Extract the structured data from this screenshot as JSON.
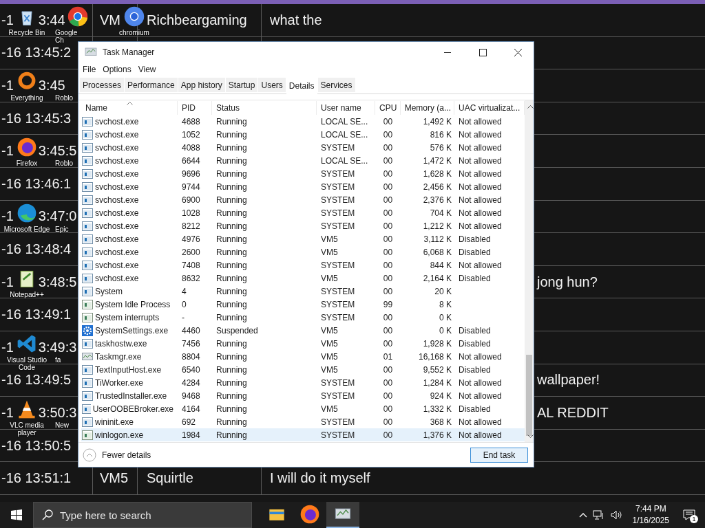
{
  "background_log": {
    "rows": [
      {
        "time": [
          "-1",
          "3:44"
        ],
        "user": "VM",
        "name": "Richbeargaming",
        "message": "what the"
      },
      {
        "time": [
          "-16 13:45:2"
        ]
      },
      {
        "time": [
          "-1",
          "3:45"
        ]
      },
      {
        "time": [
          "-16 13:45:3"
        ]
      },
      {
        "time": [
          "-1",
          "3:45:5"
        ]
      },
      {
        "time": [
          "-16 13:46:1"
        ]
      },
      {
        "time": [
          "-1",
          "3:47:0"
        ]
      },
      {
        "time": [
          "-16 13:48:4"
        ]
      },
      {
        "time": [
          "-1",
          "3:48:5"
        ],
        "message": "jong hun?"
      },
      {
        "time": [
          "-16 13:49:1"
        ]
      },
      {
        "time": [
          "-1",
          "3:49:3"
        ]
      },
      {
        "time": [
          "-16 13:49:5"
        ],
        "message": "wallpaper!"
      },
      {
        "time": [
          "-1",
          "3:50:3"
        ],
        "message": "AL REDDIT"
      },
      {
        "time": [
          "-16 13:50:5"
        ]
      },
      {
        "time": [
          "-16 13:51:1"
        ],
        "user": "VM5",
        "name": "Squirtle",
        "message": "I will do it myself"
      }
    ]
  },
  "desktop_icons": [
    {
      "label": "Recycle Bin",
      "kind": "bin"
    },
    {
      "label": "Google Ch",
      "kind": "chrome"
    },
    {
      "label": "chromium",
      "kind": "chromium"
    },
    {
      "label": "Everything",
      "kind": "ring"
    },
    {
      "label": "Roblo"
    },
    {
      "label": "Firefox",
      "kind": "fox"
    },
    {
      "label": "Roblo"
    },
    {
      "label": "Microsoft Edge",
      "kind": "edge"
    },
    {
      "label": "Epic"
    },
    {
      "label": "Notepad++",
      "kind": "note"
    },
    {
      "label": "Visual Studio Code",
      "kind": "code"
    },
    {
      "label": "fa"
    },
    {
      "label": "VLC media player",
      "kind": "cone"
    },
    {
      "label": "New"
    }
  ],
  "window": {
    "title": "Task Manager",
    "menu": [
      "File",
      "Options",
      "View"
    ],
    "tabs": [
      {
        "label": "Processes",
        "selected": false
      },
      {
        "label": "Performance",
        "selected": false
      },
      {
        "label": "App history",
        "selected": false
      },
      {
        "label": "Startup",
        "selected": false
      },
      {
        "label": "Users",
        "selected": false
      },
      {
        "label": "Details",
        "selected": true
      },
      {
        "label": "Services",
        "selected": false
      }
    ],
    "table": {
      "columns": [
        {
          "label": "Name",
          "sorted": true
        },
        {
          "label": "PID",
          "sorted": false
        },
        {
          "label": "Status",
          "sorted": false
        },
        {
          "label": "User name",
          "sorted": false
        },
        {
          "label": "CPU",
          "sorted": false
        },
        {
          "label": "Memory (a...",
          "sorted": false
        },
        {
          "label": "UAC virtualizat...",
          "sorted": false
        }
      ],
      "rows": [
        {
          "name": "svchost.exe",
          "pid": "4688",
          "status": "Running",
          "user": "LOCAL SE...",
          "cpu": "00",
          "memory": "1,492 K",
          "uac": "Not allowed",
          "kind": "exe",
          "selected": false
        },
        {
          "name": "svchost.exe",
          "pid": "1052",
          "status": "Running",
          "user": "LOCAL SE...",
          "cpu": "00",
          "memory": "816 K",
          "uac": "Not allowed",
          "kind": "exe",
          "selected": false
        },
        {
          "name": "svchost.exe",
          "pid": "4088",
          "status": "Running",
          "user": "SYSTEM",
          "cpu": "00",
          "memory": "576 K",
          "uac": "Not allowed",
          "kind": "exe",
          "selected": false
        },
        {
          "name": "svchost.exe",
          "pid": "6644",
          "status": "Running",
          "user": "LOCAL SE...",
          "cpu": "00",
          "memory": "1,472 K",
          "uac": "Not allowed",
          "kind": "exe",
          "selected": false
        },
        {
          "name": "svchost.exe",
          "pid": "9696",
          "status": "Running",
          "user": "SYSTEM",
          "cpu": "00",
          "memory": "1,628 K",
          "uac": "Not allowed",
          "kind": "exe",
          "selected": false
        },
        {
          "name": "svchost.exe",
          "pid": "9744",
          "status": "Running",
          "user": "SYSTEM",
          "cpu": "00",
          "memory": "2,456 K",
          "uac": "Not allowed",
          "kind": "exe",
          "selected": false
        },
        {
          "name": "svchost.exe",
          "pid": "6900",
          "status": "Running",
          "user": "SYSTEM",
          "cpu": "00",
          "memory": "2,376 K",
          "uac": "Not allowed",
          "kind": "exe",
          "selected": false
        },
        {
          "name": "svchost.exe",
          "pid": "1028",
          "status": "Running",
          "user": "SYSTEM",
          "cpu": "00",
          "memory": "704 K",
          "uac": "Not allowed",
          "kind": "exe",
          "selected": false
        },
        {
          "name": "svchost.exe",
          "pid": "8212",
          "status": "Running",
          "user": "SYSTEM",
          "cpu": "00",
          "memory": "1,212 K",
          "uac": "Not allowed",
          "kind": "exe",
          "selected": false
        },
        {
          "name": "svchost.exe",
          "pid": "4976",
          "status": "Running",
          "user": "VM5",
          "cpu": "00",
          "memory": "3,112 K",
          "uac": "Disabled",
          "kind": "exe",
          "selected": false
        },
        {
          "name": "svchost.exe",
          "pid": "2600",
          "status": "Running",
          "user": "VM5",
          "cpu": "00",
          "memory": "6,068 K",
          "uac": "Disabled",
          "kind": "exe",
          "selected": false
        },
        {
          "name": "svchost.exe",
          "pid": "7408",
          "status": "Running",
          "user": "SYSTEM",
          "cpu": "00",
          "memory": "844 K",
          "uac": "Not allowed",
          "kind": "exe",
          "selected": false
        },
        {
          "name": "svchost.exe",
          "pid": "8632",
          "status": "Running",
          "user": "VM5",
          "cpu": "00",
          "memory": "2,164 K",
          "uac": "Disabled",
          "kind": "exe",
          "selected": false
        },
        {
          "name": "System",
          "pid": "4",
          "status": "Running",
          "user": "SYSTEM",
          "cpu": "00",
          "memory": "20 K",
          "kind": "exe",
          "selected": false
        },
        {
          "name": "System Idle Process",
          "pid": "0",
          "status": "Running",
          "user": "SYSTEM",
          "cpu": "99",
          "memory": "8 K",
          "kind": "sys",
          "selected": false
        },
        {
          "name": "System interrupts",
          "pid": "-",
          "status": "Running",
          "user": "SYSTEM",
          "cpu": "00",
          "memory": "0 K",
          "kind": "sys",
          "selected": false
        },
        {
          "name": "SystemSettings.exe",
          "pid": "4460",
          "status": "Suspended",
          "user": "VM5",
          "cpu": "00",
          "memory": "0 K",
          "uac": "Disabled",
          "kind": "settings",
          "selected": false
        },
        {
          "name": "taskhostw.exe",
          "pid": "7456",
          "status": "Running",
          "user": "VM5",
          "cpu": "00",
          "memory": "1,928 K",
          "uac": "Disabled",
          "kind": "exe",
          "selected": false
        },
        {
          "name": "Taskmgr.exe",
          "pid": "8804",
          "status": "Running",
          "user": "VM5",
          "cpu": "01",
          "memory": "16,168 K",
          "uac": "Not allowed",
          "kind": "monitor",
          "selected": false
        },
        {
          "name": "TextInputHost.exe",
          "pid": "6540",
          "status": "Running",
          "user": "VM5",
          "cpu": "00",
          "memory": "9,552 K",
          "uac": "Disabled",
          "kind": "exe",
          "selected": false
        },
        {
          "name": "TiWorker.exe",
          "pid": "4284",
          "status": "Running",
          "user": "SYSTEM",
          "cpu": "00",
          "memory": "1,284 K",
          "uac": "Not allowed",
          "kind": "exe",
          "selected": false
        },
        {
          "name": "TrustedInstaller.exe",
          "pid": "9468",
          "status": "Running",
          "user": "SYSTEM",
          "cpu": "00",
          "memory": "924 K",
          "uac": "Not allowed",
          "kind": "exe",
          "selected": false
        },
        {
          "name": "UserOOBEBroker.exe",
          "pid": "4164",
          "status": "Running",
          "user": "VM5",
          "cpu": "00",
          "memory": "1,332 K",
          "uac": "Disabled",
          "kind": "exe",
          "selected": false
        },
        {
          "name": "wininit.exe",
          "pid": "692",
          "status": "Running",
          "user": "SYSTEM",
          "cpu": "00",
          "memory": "368 K",
          "uac": "Not allowed",
          "kind": "exe",
          "selected": false
        },
        {
          "name": "winlogon.exe",
          "pid": "1984",
          "status": "Running",
          "user": "SYSTEM",
          "cpu": "00",
          "memory": "1,376 K",
          "uac": "Not allowed",
          "kind": "sys",
          "selected": true
        }
      ]
    },
    "footer": {
      "toggle": "Fewer details",
      "button": "End task"
    }
  },
  "taskbar": {
    "search": {
      "placeholder": "Type here to search"
    },
    "apps": [
      {
        "kind": "folder",
        "active": false
      },
      {
        "kind": "fox",
        "active": false
      },
      {
        "kind": "monitor",
        "active": true
      }
    ],
    "clock": {
      "time": "7:44 PM",
      "date": "1/16/2025"
    },
    "notifications": "1"
  }
}
